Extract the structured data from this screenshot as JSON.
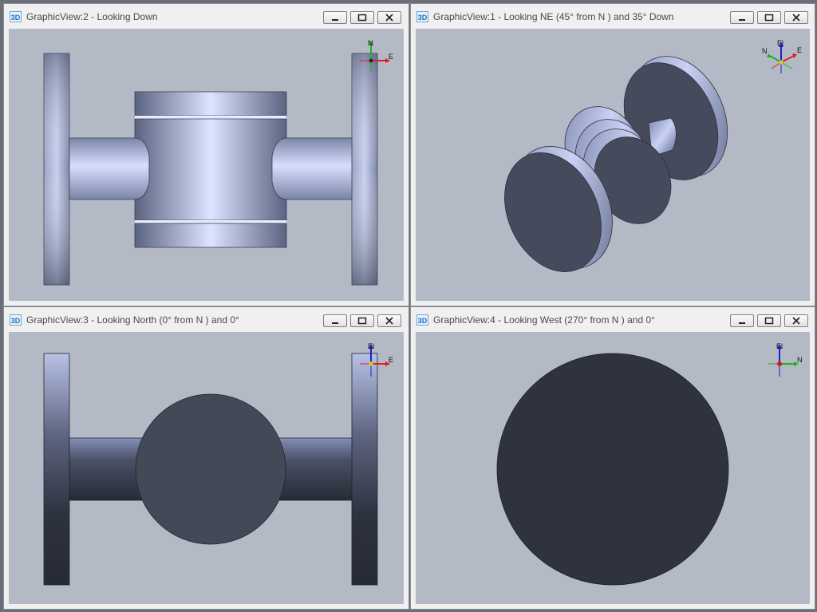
{
  "views": [
    {
      "id": "top",
      "title": "GraphicView:2 - Looking Down",
      "icon_text": "3D",
      "triad": {
        "up": "N",
        "right": "E"
      }
    },
    {
      "id": "iso",
      "title": "GraphicView:1 - Looking NE (45° from N ) and 35° Down",
      "icon_text": "3D",
      "triad": {
        "up": "El",
        "left": "N",
        "right": "E"
      }
    },
    {
      "id": "north",
      "title": "GraphicView:3 - Looking North (0° from N ) and 0°",
      "icon_text": "3D",
      "triad": {
        "up": "El",
        "right": "E"
      }
    },
    {
      "id": "west",
      "title": "GraphicView:4 - Looking West (270° from N ) and 0°",
      "icon_text": "3D",
      "triad": {
        "up": "El",
        "right": "N"
      }
    }
  ],
  "window_buttons": [
    "minimize-icon",
    "maximize-icon",
    "close-icon"
  ],
  "colors": {
    "viewport_bg": "#b4b9c6",
    "model_dark": "#2f333d",
    "model_face": "#434957",
    "axis_x": "#e02020",
    "axis_y": "#20b020",
    "axis_z": "#2020d0"
  }
}
